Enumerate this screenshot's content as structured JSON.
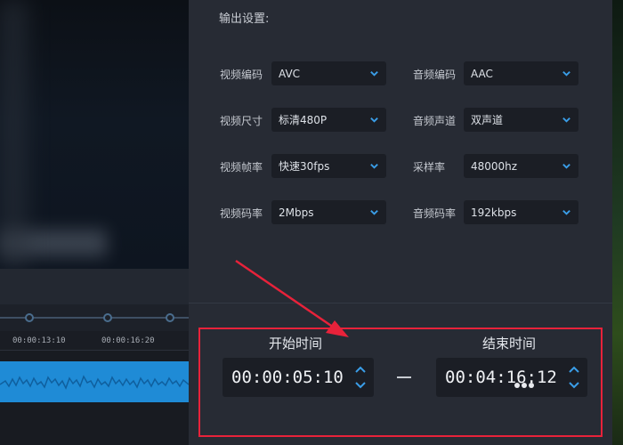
{
  "output_settings": {
    "title": "输出设置:",
    "video": [
      {
        "label": "视频编码",
        "value": "AVC"
      },
      {
        "label": "视频尺寸",
        "value": "标清480P"
      },
      {
        "label": "视频帧率",
        "value": "快速30fps"
      },
      {
        "label": "视频码率",
        "value": "2Mbps"
      }
    ],
    "audio": [
      {
        "label": "音频编码",
        "value": "AAC"
      },
      {
        "label": "音频声道",
        "value": "双声道"
      },
      {
        "label": "采样率",
        "value": "48000hz"
      },
      {
        "label": "音频码率",
        "value": "192kbps"
      }
    ]
  },
  "time_range": {
    "start_label": "开始时间",
    "start_value": "00:00:05:10",
    "end_label": "结束时间",
    "end_value": "00:04:16:12",
    "separator": "—"
  },
  "timeline": {
    "ruler": [
      "00:00:13:10",
      "00:00:16:20"
    ]
  },
  "colors": {
    "accent": "#1f8bd6",
    "annotation": "#e8223a",
    "chevron": "#3a9ee8"
  }
}
